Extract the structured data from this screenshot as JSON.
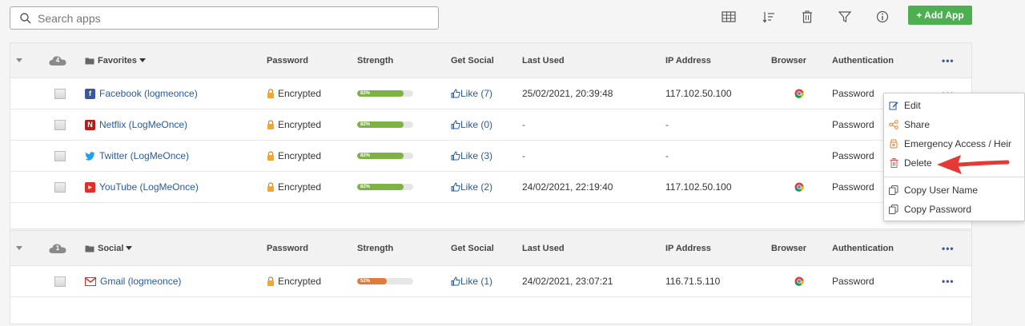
{
  "search": {
    "placeholder": "Search apps"
  },
  "toolbar": {
    "add_app_label": "+ Add App",
    "icons": [
      "grid-icon",
      "sort-icon",
      "trash-icon",
      "filter-icon",
      "info-icon"
    ]
  },
  "columns": {
    "password": "Password",
    "strength": "Strength",
    "get_social": "Get Social",
    "last_used": "Last Used",
    "ip_address": "IP Address",
    "browser": "Browser",
    "authentication": "Authentication",
    "more": "•••"
  },
  "groups": [
    {
      "name": "Favorites",
      "count": "4",
      "rows": [
        {
          "app": "Facebook (logmeonce)",
          "icon": "facebook-icon",
          "password": "Encrypted",
          "strength": 82,
          "strength_label": "82%",
          "social": "Like (7)",
          "last_used": "25/02/2021, 20:39:48",
          "ip": "117.102.50.100",
          "browser": "chrome",
          "auth": "Password",
          "more": "•••"
        },
        {
          "app": "Netflix (LogMeOnce)",
          "icon": "netflix-icon",
          "password": "Encrypted",
          "strength": 82,
          "strength_label": "82%",
          "social": "Like (0)",
          "last_used": "-",
          "ip": "-",
          "browser": "",
          "auth": "Password",
          "more": "•••"
        },
        {
          "app": "Twitter (LogMeOnce)",
          "icon": "twitter-icon",
          "password": "Encrypted",
          "strength": 82,
          "strength_label": "82%",
          "social": "Like (3)",
          "last_used": "-",
          "ip": "-",
          "browser": "",
          "auth": "Password",
          "more": "•••"
        },
        {
          "app": "YouTube (LogMeOnce)",
          "icon": "youtube-icon",
          "password": "Encrypted",
          "strength": 82,
          "strength_label": "82%",
          "social": "Like (2)",
          "last_used": "24/02/2021, 22:19:40",
          "ip": "117.102.50.100",
          "browser": "chrome",
          "auth": "Password",
          "more": "•••"
        }
      ]
    },
    {
      "name": "Social",
      "count": "1",
      "rows": [
        {
          "app": "Gmail (logmeonce)",
          "icon": "gmail-icon",
          "password": "Encrypted",
          "strength": 52,
          "strength_label": "52%",
          "social": "Like (1)",
          "last_used": "24/02/2021, 23:07:21",
          "ip": "116.71.5.110",
          "browser": "chrome",
          "auth": "Password",
          "more": "•••"
        }
      ]
    }
  ],
  "context_menu": {
    "items": [
      {
        "label": "Edit",
        "icon": "edit-icon",
        "color": "#2a5a97"
      },
      {
        "label": "Share",
        "icon": "share-icon",
        "color": "#e67e22"
      },
      {
        "label": "Emergency Access / Heir",
        "icon": "emergency-icon",
        "color": "#e67e22"
      },
      {
        "label": "Delete",
        "icon": "trash-icon",
        "color": "#d9534f"
      },
      {
        "label": "Copy User Name",
        "icon": "copy-icon",
        "color": "#555"
      },
      {
        "label": "Copy Password",
        "icon": "copy-icon",
        "color": "#555"
      }
    ]
  },
  "colors": {
    "accent_green": "#4caf50",
    "strength_good": "#7cb342",
    "strength_medium": "#e07b39",
    "link": "#2a5a97",
    "annotation_arrow": "#e53935"
  }
}
